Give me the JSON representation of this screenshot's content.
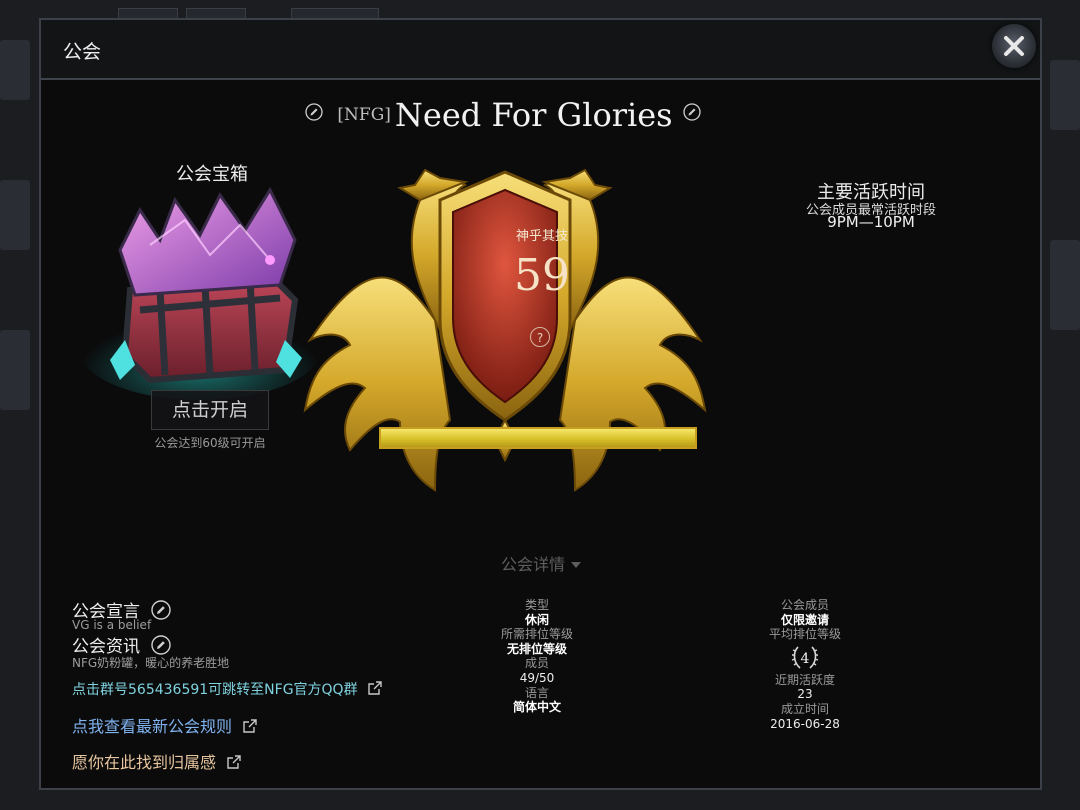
{
  "modal": {
    "title": "公会"
  },
  "guild": {
    "tag": "[NFG]",
    "name": "Need For Glories"
  },
  "chest": {
    "title": "公会宝箱",
    "open_label": "点击开启",
    "note": "公会达到60级可开启"
  },
  "rank": {
    "name": "神乎其技",
    "level": "59",
    "help": "?",
    "progress_fraction": 1.0
  },
  "active": {
    "title": "主要活跃时间",
    "subtitle": "公会成员最常活跃时段",
    "time": "9PM—10PM"
  },
  "details_label": "公会详情",
  "left": {
    "manifesto_label": "公会宣言",
    "manifesto_text": "VG is a belief",
    "news_label": "公会资讯",
    "news_text": "NFG奶粉罐，暖心的养老胜地",
    "link_qq": "点击群号565436591可跳转至NFG官方QQ群",
    "link_rules": "点我查看最新公会规则",
    "link_belong": "愿你在此找到归属感"
  },
  "middle": {
    "type_label": "类型",
    "type_value": "休闲",
    "rank_req_label": "所需排位等级",
    "rank_req_value": "无排位等级",
    "members_label": "成员",
    "members_value": "49/50",
    "lang_label": "语言",
    "lang_value": "简体中文"
  },
  "right": {
    "membership_label": "公会成员",
    "membership_value": "仅限邀请",
    "avg_rank_label": "平均排位等级",
    "avg_rank_value": "4",
    "activity_label": "近期活跃度",
    "activity_value": "23",
    "founded_label": "成立时间",
    "founded_value": "2016-06-28"
  },
  "colors": {
    "link_qq": "#7fd3df",
    "link_rules": "#7fb2ee",
    "link_belong": "#e8c6a0",
    "gold": "#d4a82a"
  }
}
